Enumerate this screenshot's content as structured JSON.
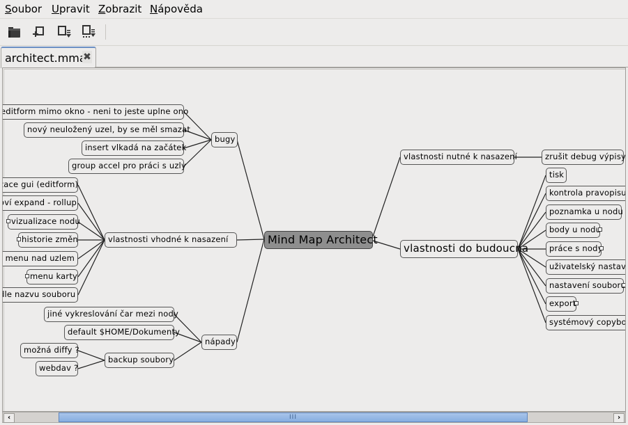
{
  "menubar": {
    "items": [
      {
        "label_u": "S",
        "label_rest": "oubor"
      },
      {
        "label_u": "U",
        "label_rest": "pravit"
      },
      {
        "label_u": "Z",
        "label_rest": "obrazit"
      },
      {
        "label_u": "N",
        "label_rest": "ápověda"
      }
    ]
  },
  "toolbar": {
    "buttons": [
      {
        "icon": "open-folder-icon"
      },
      {
        "icon": "add-node-icon"
      },
      {
        "icon": "add-child-node-icon"
      },
      {
        "icon": "add-sibling-node-icon"
      }
    ]
  },
  "tabs": [
    {
      "label": "architect.mma",
      "close": "✖"
    }
  ],
  "mindmap": {
    "root": "Mind Map Architect",
    "bugy": {
      "label": "bugy",
      "children": [
        "editform mimo okno - neni to jeste uplne ono",
        "nový neuložený uzel, by se měl smazat",
        "insert vlkadá na začátek",
        "group accel pro práci s uzly"
      ]
    },
    "vhodne": {
      "label": "vlastnosti vhodné k nasazení",
      "children": [
        "zace gui (editform)",
        "oví expand - rollup",
        "vizualizace nodu",
        "historie změn",
        "t menu nad uzlem",
        "menu karty",
        "dle nazvu souboru"
      ]
    },
    "napady": {
      "label": "nápady",
      "children": [
        "jiné vykreslování čar mezi nody",
        "default $HOME/Dokumenty"
      ],
      "backup": {
        "label": "backup soubory",
        "children": [
          "možná diffy ?",
          "webdav ?"
        ]
      }
    },
    "nutne": {
      "label": "vlastnosti nutné k nasazení",
      "children": [
        "zrušit debug výpisy"
      ]
    },
    "budoucna": {
      "label": "vlastnosti do budoucna",
      "children": [
        "tisk",
        "kontrola pravopisu",
        "poznamka u nodu",
        "body u nodu",
        "práce s nody",
        "uživatelský nastave",
        "nastavení souboru",
        "export",
        "systémový copybor"
      ]
    }
  },
  "scrollbar": {
    "left_arrow": "‹",
    "right_arrow": "›",
    "grip": "III"
  }
}
